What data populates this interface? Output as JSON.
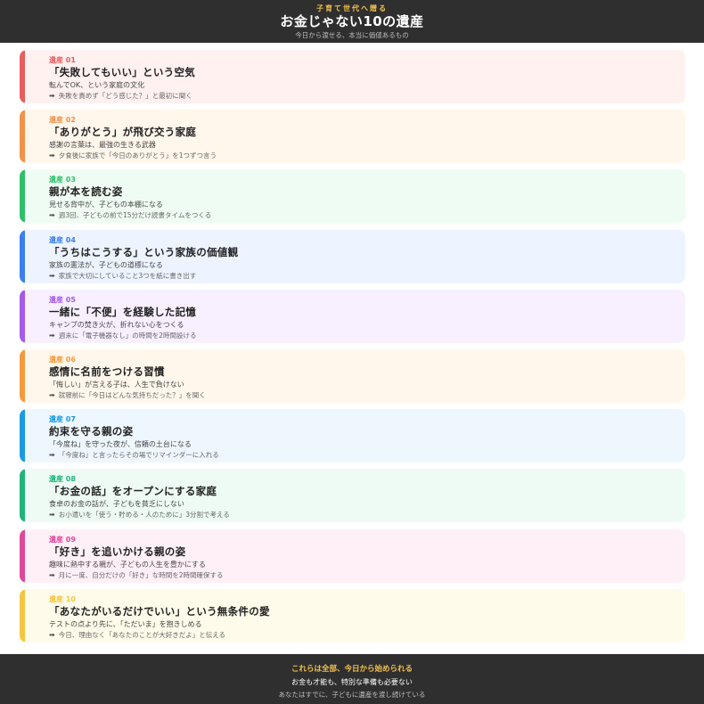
{
  "header": {
    "kicker": "子育て世代へ贈る",
    "title": "お金じゃない10の遺産",
    "subtitle": "今日から渡せる、本当に価値あるもの"
  },
  "items": [
    {
      "label": "遺産 01",
      "heading": "「失敗してもいい」という空気",
      "desc": "転んでOK、という家庭の文化",
      "action": "失敗を責めず「どう感じた？」と最初に聞く",
      "accent": "#e85d5d",
      "bg": "#fff1f0",
      "icon": "arrow-right-icon"
    },
    {
      "label": "遺産 02",
      "heading": "「ありがとう」が飛び交う家庭",
      "desc": "感謝の言葉は、最強の生きる武器",
      "action": "夕食後に家族で「今日のありがとう」を1つずつ言う",
      "accent": "#f0924a",
      "bg": "#fff6ec",
      "icon": "arrow-right-icon"
    },
    {
      "label": "遺産 03",
      "heading": "親が本を読む姿",
      "desc": "見せる背中が、子どもの本棚になる",
      "action": "週3回、子どもの前で15分だけ読書タイムをつくる",
      "accent": "#2fbf6a",
      "bg": "#effcf3",
      "icon": "arrow-right-icon"
    },
    {
      "label": "遺産 04",
      "heading": "「うちはこうする」という家族の価値観",
      "desc": "家族の憲法が、子どもの道標になる",
      "action": "家族で大切にしていること3つを紙に書き出す",
      "accent": "#3b7ff0",
      "bg": "#edf4ff",
      "icon": "arrow-right-icon"
    },
    {
      "label": "遺産 05",
      "heading": "一緒に「不便」を経験した記憶",
      "desc": "キャンプの焚き火が、折れない心をつくる",
      "action": "週末に「電子機器なし」の時間を2時間設ける",
      "accent": "#a65ae8",
      "bg": "#f8f0ff",
      "icon": "arrow-right-icon"
    },
    {
      "label": "遺産 06",
      "heading": "感情に名前をつける習慣",
      "desc": "「悔しい」が言える子は、人生で負けない",
      "action": "就寝前に「今日はどんな気持ちだった？」を聞く",
      "accent": "#f59a3c",
      "bg": "#fff7ec",
      "icon": "arrow-right-icon"
    },
    {
      "label": "遺産 07",
      "heading": "約束を守る親の姿",
      "desc": "「今度ね」を守った夜が、信頼の土台になる",
      "action": "「今度ね」と言ったらその場でリマインダーに入れる",
      "accent": "#1a9be0",
      "bg": "#eef7fd",
      "icon": "arrow-right-icon"
    },
    {
      "label": "遺産 08",
      "heading": "「お金の話」をオープンにする家庭",
      "desc": "食卓のお金の話が、子どもを貧乏にしない",
      "action": "お小遣いを「使う・貯める・人のために」3分割で考える",
      "accent": "#1fb57a",
      "bg": "#edfbf4",
      "icon": "arrow-right-icon"
    },
    {
      "label": "遺産 09",
      "heading": "「好き」を追いかける親の姿",
      "desc": "趣味に熱中する親が、子どもの人生を豊かにする",
      "action": "月に一度、自分だけの「好き」な時間を2時間確保する",
      "accent": "#e0489a",
      "bg": "#fff0f7",
      "icon": "arrow-right-icon"
    },
    {
      "label": "遺産 10",
      "heading": "「あなたがいるだけでいい」という無条件の愛",
      "desc": "テストの点より先に、「ただいま」を抱きしめる",
      "action": "今日、理由なく「あなたのことが大好きだよ」と伝える",
      "accent": "#f5c542",
      "bg": "#fffbea",
      "icon": "arrow-right-icon"
    }
  ],
  "footer": {
    "line1": "これらは全部、今日から始められる",
    "line2": "お金も才能も、特別な準備も必要ない",
    "line3": "あなたはすでに、子どもに遺産を渡し続けている"
  }
}
